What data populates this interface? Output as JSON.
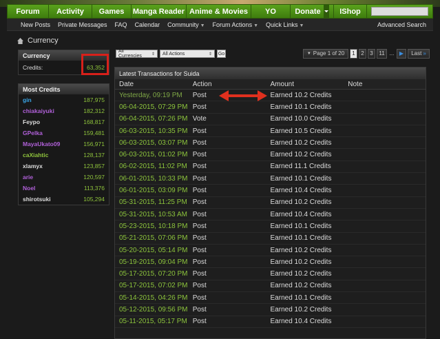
{
  "nav": {
    "items": [
      "Forum",
      "Activity",
      "Games",
      "Manga Reader",
      "Anime & Movies",
      "YO",
      "Donate",
      "IShop"
    ],
    "search_placeholder": ""
  },
  "subnav": {
    "items": [
      "New Posts",
      "Private Messages",
      "FAQ",
      "Calendar",
      "Community",
      "Forum Actions",
      "Quick Links"
    ],
    "dropdown_flags": [
      false,
      false,
      false,
      false,
      true,
      true,
      true
    ],
    "right": "Advanced Search"
  },
  "breadcrumb": {
    "label": "Currency"
  },
  "currency_box": {
    "title": "Currency",
    "label": "Credits:",
    "value": "63,352"
  },
  "most_credits": {
    "title": "Most Credits",
    "rows": [
      {
        "name": "gin",
        "value": "187,975",
        "color": "#3aa6e8"
      },
      {
        "name": "chiakaiyuki",
        "value": "182,312",
        "color": "#b060d8"
      },
      {
        "name": "Feypo",
        "value": "168,817",
        "color": "#dddddd"
      },
      {
        "name": "GPelka",
        "value": "159,481",
        "color": "#b060d8"
      },
      {
        "name": "MayaUkato09",
        "value": "156,971",
        "color": "#b060d8"
      },
      {
        "name": "caXiahtic",
        "value": "128,137",
        "color": "#8fc43c"
      },
      {
        "name": "xlamyx",
        "value": "123,857",
        "color": "#dddddd"
      },
      {
        "name": "arie",
        "value": "120,597",
        "color": "#b060d8"
      },
      {
        "name": "Noel",
        "value": "113,376",
        "color": "#b060d8"
      },
      {
        "name": "shirotsuki",
        "value": "105,294",
        "color": "#dddddd"
      }
    ]
  },
  "controls": {
    "currency_select": "All Currencies",
    "action_select": "All Actions",
    "go": "Go"
  },
  "pager": {
    "label": "Page 1 of 20",
    "pages": [
      "1",
      "2",
      "3",
      "11",
      "..."
    ],
    "last": "Last"
  },
  "transactions": {
    "title": "Latest Transactions for Suida",
    "headers": [
      "Date",
      "Action",
      "Amount",
      "Note"
    ],
    "rows": [
      {
        "date": "Yesterday, 09:19 PM",
        "action": "Post",
        "amount": "Earned 10.2 Credits"
      },
      {
        "date": "06-04-2015, 07:29 PM",
        "action": "Post",
        "amount": "Earned 10.1 Credits"
      },
      {
        "date": "06-04-2015, 07:26 PM",
        "action": "Vote",
        "amount": "Earned 10.0 Credits"
      },
      {
        "date": "06-03-2015, 10:35 PM",
        "action": "Post",
        "amount": "Earned 10.5 Credits"
      },
      {
        "date": "06-03-2015, 03:07 PM",
        "action": "Post",
        "amount": "Earned 10.2 Credits"
      },
      {
        "date": "06-03-2015, 01:02 PM",
        "action": "Post",
        "amount": "Earned 10.2 Credits"
      },
      {
        "date": "06-02-2015, 11:02 PM",
        "action": "Post",
        "amount": "Earned 11.1 Credits"
      },
      {
        "date": "06-01-2015, 10:33 PM",
        "action": "Post",
        "amount": "Earned 10.1 Credits"
      },
      {
        "date": "06-01-2015, 03:09 PM",
        "action": "Post",
        "amount": "Earned 10.4 Credits"
      },
      {
        "date": "05-31-2015, 11:25 PM",
        "action": "Post",
        "amount": "Earned 10.2 Credits"
      },
      {
        "date": "05-31-2015, 10:53 AM",
        "action": "Post",
        "amount": "Earned 10.4 Credits"
      },
      {
        "date": "05-23-2015, 10:18 PM",
        "action": "Post",
        "amount": "Earned 10.1 Credits"
      },
      {
        "date": "05-21-2015, 07:06 PM",
        "action": "Post",
        "amount": "Earned 10.1 Credits"
      },
      {
        "date": "05-20-2015, 05:14 PM",
        "action": "Post",
        "amount": "Earned 10.2 Credits"
      },
      {
        "date": "05-19-2015, 09:04 PM",
        "action": "Post",
        "amount": "Earned 10.2 Credits"
      },
      {
        "date": "05-17-2015, 07:20 PM",
        "action": "Post",
        "amount": "Earned 10.2 Credits"
      },
      {
        "date": "05-17-2015, 07:02 PM",
        "action": "Post",
        "amount": "Earned 10.2 Credits"
      },
      {
        "date": "05-14-2015, 04:26 PM",
        "action": "Post",
        "amount": "Earned 10.1 Credits"
      },
      {
        "date": "05-12-2015, 09:56 PM",
        "action": "Post",
        "amount": "Earned 10.2 Credits"
      },
      {
        "date": "05-11-2015, 05:17 PM",
        "action": "Post",
        "amount": "Earned 10.4 Credits"
      }
    ]
  }
}
